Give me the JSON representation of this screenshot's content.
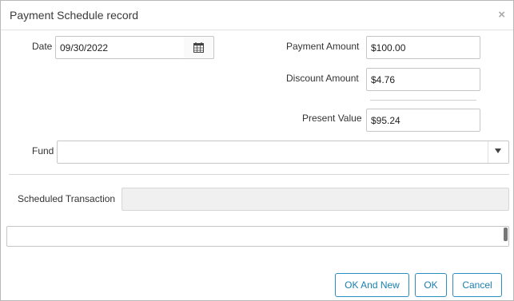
{
  "dialog": {
    "title": "Payment Schedule record",
    "close_glyph": "×"
  },
  "form": {
    "date_label": "Date",
    "date_value": "09/30/2022",
    "payment_amount_label": "Payment Amount",
    "payment_amount_value": "$100.00",
    "discount_amount_label": "Discount Amount",
    "discount_amount_value": "$4.76",
    "present_value_label": "Present Value",
    "present_value_value": "$95.24",
    "fund_label": "Fund",
    "fund_value": "",
    "scheduled_transaction_label": "Scheduled Transaction",
    "scheduled_transaction_value": "",
    "notes_value": ""
  },
  "buttons": {
    "ok_and_new": "OK And New",
    "ok": "OK",
    "cancel": "Cancel"
  },
  "icons": {
    "calendar": "calendar-icon",
    "close": "close-icon",
    "dropdown": "chevron-down-icon"
  }
}
